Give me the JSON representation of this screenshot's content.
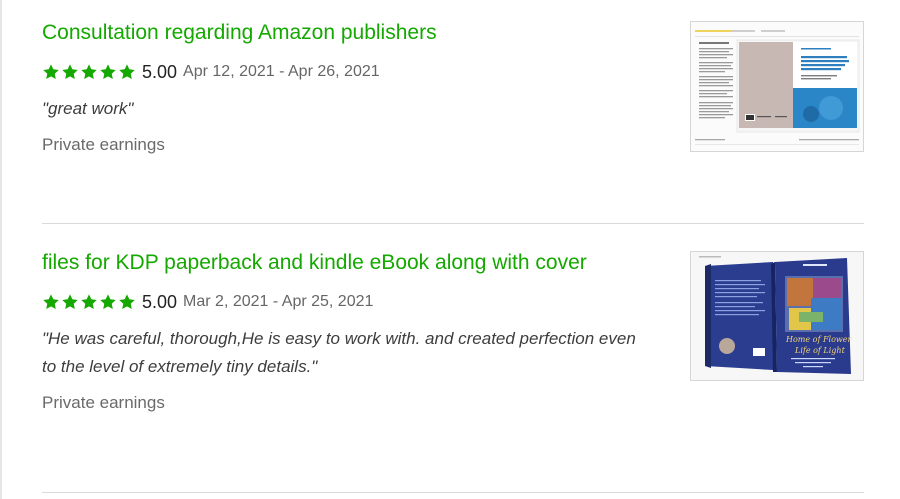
{
  "items": [
    {
      "title": "Consultation regarding Amazon publishers",
      "rating": "5.00",
      "stars": 5,
      "date_range": "Apr 12, 2021 - Apr 26, 2021",
      "feedback": "\"great work\"",
      "earnings": "Private earnings",
      "thumbnail_icon": "book-layout-thumbnail-icon"
    },
    {
      "title": "files for KDP paperback and kindle eBook along with cover",
      "rating": "5.00",
      "stars": 5,
      "date_range": "Mar 2, 2021 - Apr 25, 2021",
      "feedback": "\"He was careful, thorough,He is easy to work with. and created perfection even to the level of extremely tiny details.\"",
      "earnings": "Private earnings",
      "thumbnail_icon": "book-cover-thumbnail-icon"
    }
  ],
  "colors": {
    "accent": "#14a800",
    "divider": "#d9d9d9"
  }
}
